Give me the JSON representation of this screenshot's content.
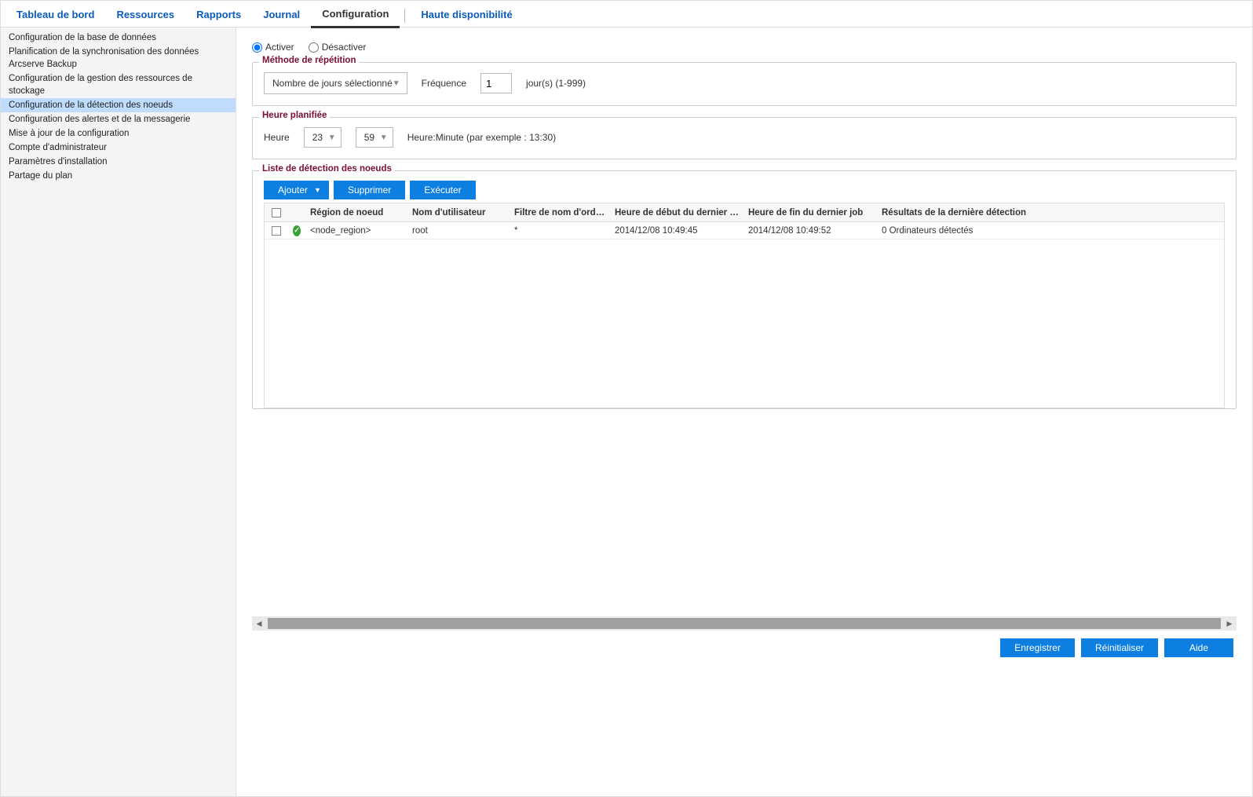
{
  "topTabs": {
    "dashboard": "Tableau de bord",
    "resources": "Ressources",
    "reports": "Rapports",
    "journal": "Journal",
    "config": "Configuration",
    "ha": "Haute disponibilité"
  },
  "sidebar": {
    "items": [
      "Configuration de la base de données",
      "Planification de la synchronisation des données Arcserve Backup",
      "Configuration de la gestion des ressources de stockage",
      "Configuration de la détection des noeuds",
      "Configuration des alertes et de la messagerie",
      "Mise à jour de la configuration",
      "Compte d'administrateur",
      "Paramètres d'installation",
      "Partage du plan"
    ],
    "activeIndex": 3
  },
  "activation": {
    "activate": "Activer",
    "deactivate": "Désactiver",
    "selected": "activate"
  },
  "repeat": {
    "legend": "Méthode de répétition",
    "modeLabel": "Nombre de jours sélectionné",
    "freqLabel": "Fréquence",
    "freqValue": "1",
    "freqUnit": "jour(s) (1-999)"
  },
  "schedule": {
    "legend": "Heure planifiée",
    "label": "Heure",
    "hour": "23",
    "minute": "59",
    "hint": "Heure:Minute (par exemple : 13:30)"
  },
  "list": {
    "legend": "Liste de détection des noeuds",
    "toolbar": {
      "add": "Ajouter",
      "delete": "Supprimer",
      "execute": "Exécuter"
    },
    "columns": {
      "region": "Région de noeud",
      "user": "Nom d'utilisateur",
      "filter": "Filtre de nom d'ordinateur",
      "start": "Heure de début du dernier job",
      "end": "Heure de fin du dernier job",
      "result": "Résultats de la dernière détection"
    },
    "rows": [
      {
        "status": "ok",
        "region": "<node_region>",
        "user": "root",
        "filter": "*",
        "start": "2014/12/08 10:49:45",
        "end": "2014/12/08 10:49:52",
        "result": "0 Ordinateurs détectés"
      }
    ]
  },
  "footer": {
    "save": "Enregistrer",
    "reset": "Réinitialiser",
    "help": "Aide"
  }
}
